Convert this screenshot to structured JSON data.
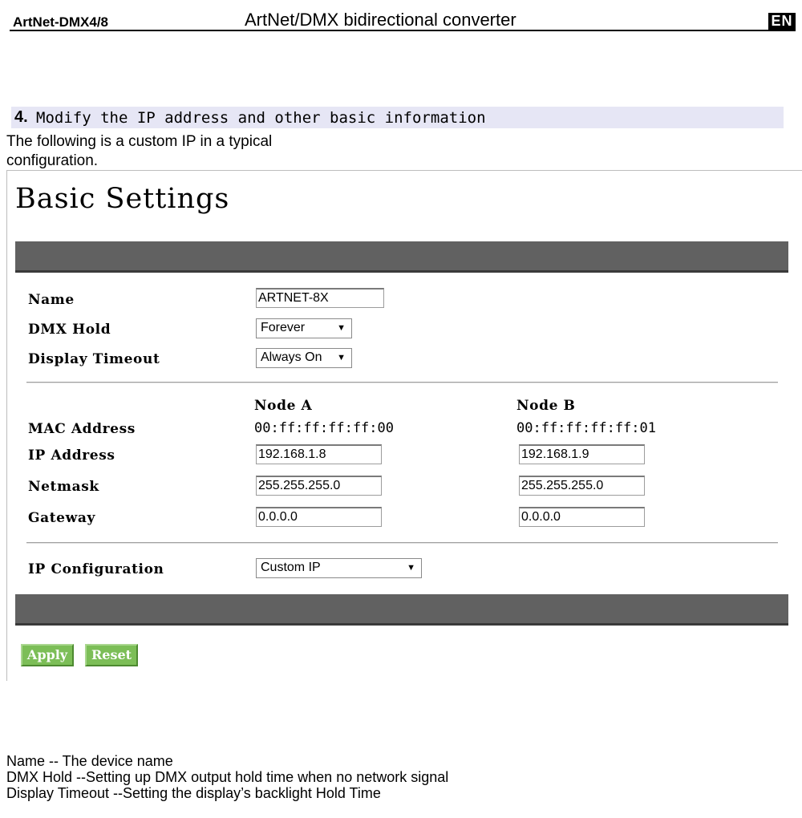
{
  "document": {
    "product": "ArtNet-DMX4/8",
    "title": "ArtNet/DMX bidirectional converter",
    "language_badge": "EN"
  },
  "section": {
    "number": "4.",
    "heading": "Modify the IP address and other basic information",
    "intro": "The following is a custom IP in a typical configuration."
  },
  "settings_page": {
    "heading": "Basic Settings",
    "name": {
      "label": "Name",
      "value": "ARTNET-8X"
    },
    "dmx_hold": {
      "label": "DMX Hold",
      "value": "Forever"
    },
    "display_timeout": {
      "label": "Display Timeout",
      "value": "Always On"
    },
    "nodes": {
      "node_a_header": "Node A",
      "node_b_header": "Node B"
    },
    "mac": {
      "label": "MAC Address",
      "node_a": "00:ff:ff:ff:ff:00",
      "node_b": "00:ff:ff:ff:ff:01"
    },
    "ip": {
      "label": "IP Address",
      "node_a": "192.168.1.8",
      "node_b": "192.168.1.9"
    },
    "netmask": {
      "label": "Netmask",
      "node_a": "255.255.255.0",
      "node_b": "255.255.255.0"
    },
    "gateway": {
      "label": "Gateway",
      "node_a": "0.0.0.0",
      "node_b": "0.0.0.0"
    },
    "ip_config": {
      "label": "IP Configuration",
      "value": "Custom IP"
    },
    "buttons": {
      "apply": "Apply",
      "reset": "Reset"
    },
    "dropdown_icon": "triangle-down-icon"
  },
  "notes": [
    "Name -- The device name",
    "DMX Hold --Setting up DMX output hold time when no network signal",
    "Display Timeout --Setting the display’s backlight Hold Time"
  ],
  "colors": {
    "section_bar": "#e6e6f5",
    "dark_bar": "#616161",
    "button_green": "#7cbe57"
  }
}
